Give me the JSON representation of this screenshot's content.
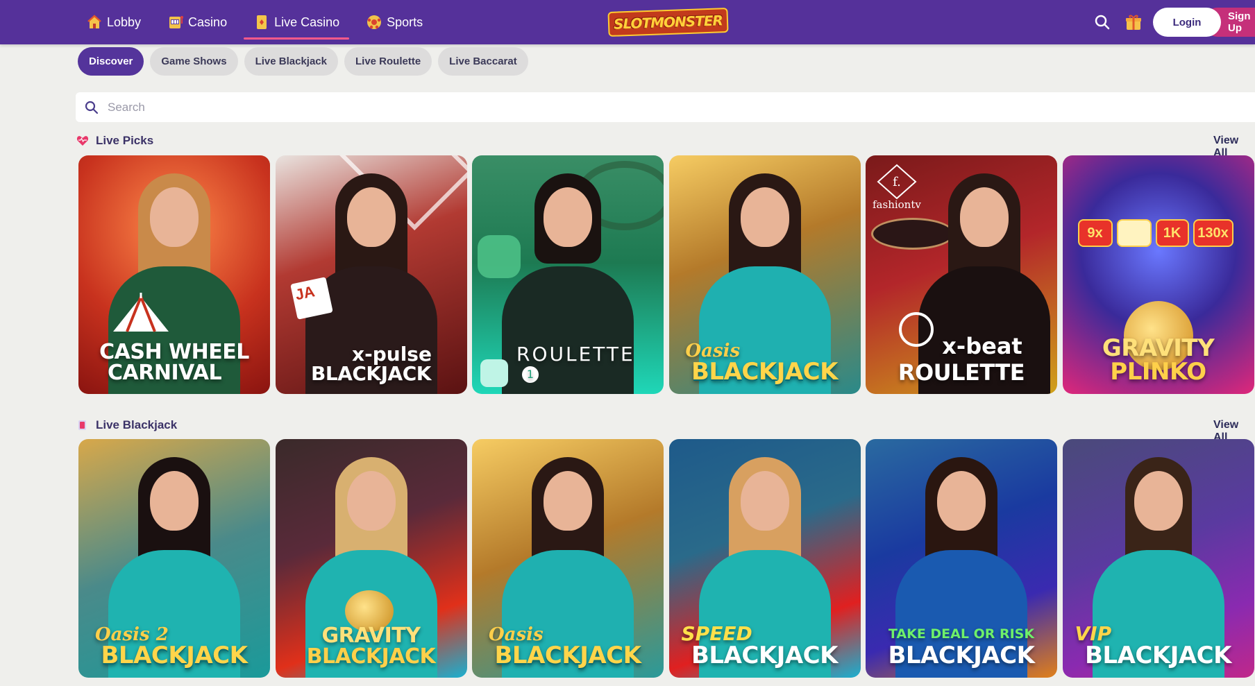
{
  "header": {
    "nav": [
      {
        "label": "Lobby",
        "icon": "house-icon",
        "active": false
      },
      {
        "label": "Casino",
        "icon": "slot-machine-icon",
        "active": false
      },
      {
        "label": "Live Casino",
        "icon": "card-icon",
        "active": true
      },
      {
        "label": "Sports",
        "icon": "soccer-ball-icon",
        "active": false
      }
    ],
    "logo": "SLOTMONSTER",
    "login_label": "Login",
    "signup_label": "Sign Up"
  },
  "chips": [
    {
      "label": "Discover",
      "active": true
    },
    {
      "label": "Game Shows",
      "active": false
    },
    {
      "label": "Live Blackjack",
      "active": false
    },
    {
      "label": "Live Roulette",
      "active": false
    },
    {
      "label": "Live Baccarat",
      "active": false
    }
  ],
  "search": {
    "placeholder": "Search",
    "value": ""
  },
  "sections": [
    {
      "title": "Live Picks",
      "icon": "heart-icon",
      "view_all": "View All",
      "games": [
        {
          "line1": "CASH WHEEL",
          "line2": "CARNIVAL"
        },
        {
          "line1": "x-pulse",
          "line2": "BLACKJACK"
        },
        {
          "line1": "ROULETTE",
          "line2": ""
        },
        {
          "line1": "Oasis",
          "line2": "BLACKJACK"
        },
        {
          "line1": "x-beat",
          "line2": "ROULETTE",
          "brand": "fashiontv"
        },
        {
          "line1": "GRAVITY",
          "line2": "PLINKO",
          "multipliers": [
            "9x",
            "1K",
            "130x"
          ]
        }
      ]
    },
    {
      "title": "Live Blackjack",
      "icon": "cards-icon",
      "view_all": "View All",
      "games": [
        {
          "line1": "Oasis 2",
          "line2": "BLACKJACK"
        },
        {
          "line1": "GRAVITY",
          "line2": "BLACKJACK"
        },
        {
          "line1": "Oasis",
          "line2": "BLACKJACK"
        },
        {
          "line1": "SPEED",
          "line2": "BLACKJACK"
        },
        {
          "line1": "TAKE DEAL OR RISK",
          "line2": "BLACKJACK"
        },
        {
          "line1": "VIP",
          "line2": "BLACKJACK"
        }
      ]
    }
  ],
  "colors": {
    "header_bg": "#55319a",
    "accent": "#ff5a8a",
    "signup": "#c5307a",
    "page_bg": "#efefec"
  }
}
